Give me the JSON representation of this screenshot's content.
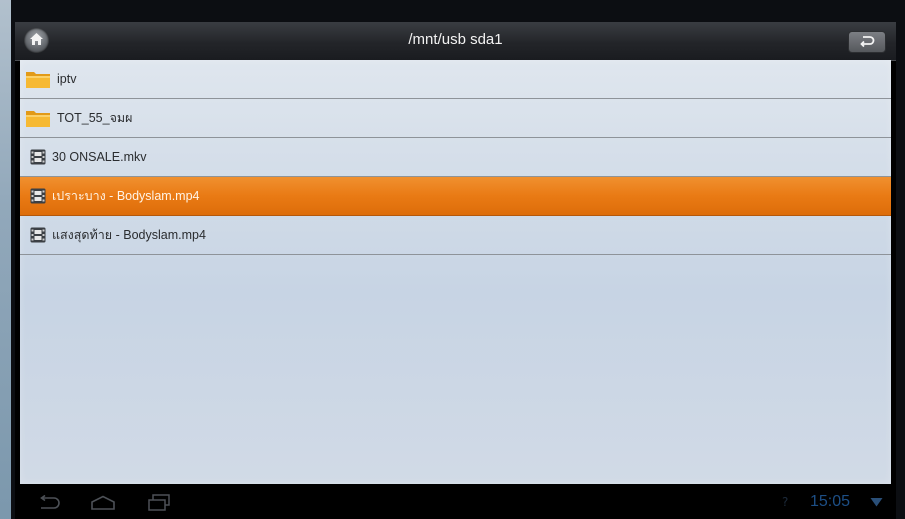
{
  "window": {
    "title": "/mnt/usb sda1"
  },
  "toolbar": {
    "home_icon": "home-icon",
    "back_icon": "return-arrow-icon"
  },
  "files": [
    {
      "name": "iptv",
      "type": "folder",
      "icon": "folder-icon",
      "selected": false
    },
    {
      "name": "TOT_55_จมผ",
      "type": "folder",
      "icon": "folder-icon",
      "selected": false
    },
    {
      "name": "30 ONSALE.mkv",
      "type": "video",
      "icon": "film-icon",
      "selected": false
    },
    {
      "name": "เปราะบาง - Bodyslam.mp4",
      "type": "video",
      "icon": "film-icon",
      "selected": true
    },
    {
      "name": "แสงสุดท้าย - Bodyslam.mp4",
      "type": "video",
      "icon": "film-icon",
      "selected": false
    }
  ],
  "navbar": {
    "buttons": [
      "back-icon",
      "home-icon",
      "recent-apps-icon"
    ]
  },
  "status": {
    "question_mark": "?",
    "time": "15:05",
    "signal_icon": "wifi-icon"
  },
  "colors": {
    "selected_row": "#ec7f18",
    "list_background": "#d2dce8",
    "clock": "#1d4f86"
  }
}
